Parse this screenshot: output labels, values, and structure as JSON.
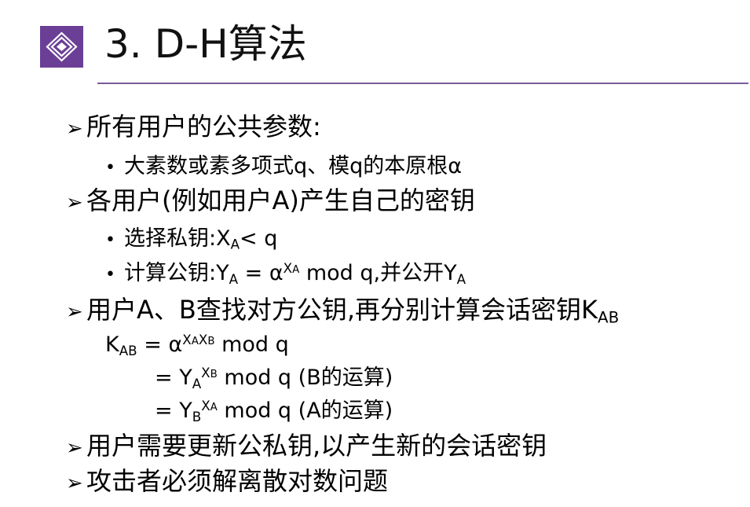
{
  "header": {
    "title": "3. D-H算法",
    "logo_icon": "diamond-logo-icon",
    "accent_color": "#6b3f96",
    "rule_color": "#7a5c9a"
  },
  "symbols": {
    "arrow": "➢",
    "dot": "•"
  },
  "content": {
    "b1": "所有用户的公共参数:",
    "b1_s1": "大素数或素多项式q、模q的本原根α",
    "b2": "各用户(例如用户A)产生自己的密钥",
    "b2_s1": {
      "pre": "选择私钥:X",
      "sub": "A",
      "post": "< q"
    },
    "b2_s2": {
      "pre": "计算公钥:Y",
      "sub1": "A",
      "mid1": " = α",
      "sup": "X",
      "supsub": "A",
      "mid2": " mod q,并公开Y",
      "sub2": "A"
    },
    "b3": {
      "pre": "用户A、B查找对方公钥,再分别计算会话密钥K",
      "sub": "AB"
    },
    "eq1": {
      "k": "K",
      "ksub": "AB",
      "mid": " = α",
      "s1": "X",
      "s1sub": "A",
      "s2": "X",
      "s2sub": "B",
      "post": " mod q"
    },
    "eq2": {
      "pre": "= Y",
      "sub": "A",
      "sup": "X",
      "supsub": "B",
      "post": " mod q (B的运算)"
    },
    "eq3": {
      "pre": "= Y",
      "sub": "B",
      "sup": "X",
      "supsub": "A",
      "post": " mod q (A的运算)"
    },
    "b4": "用户需要更新公私钥,以产生新的会话密钥",
    "b5": "攻击者必须解离散对数问题"
  }
}
